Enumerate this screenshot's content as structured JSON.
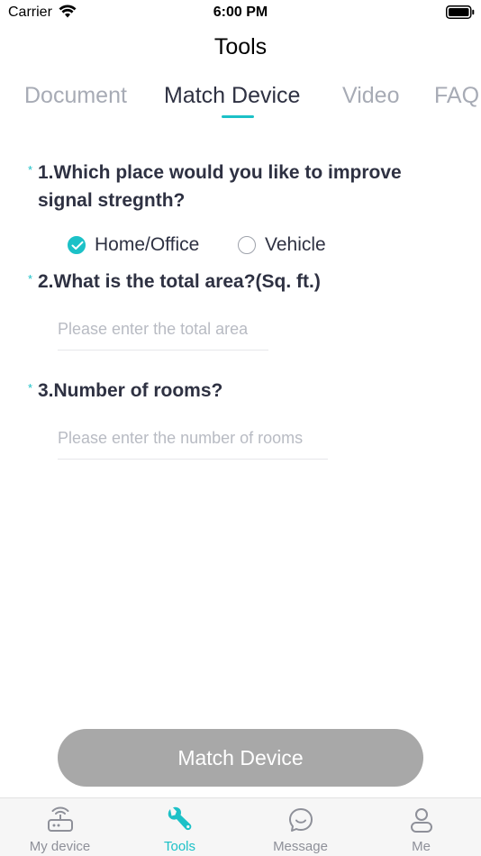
{
  "status_bar": {
    "carrier": "Carrier",
    "time": "6:00 PM"
  },
  "nav": {
    "title": "Tools"
  },
  "tabs": [
    {
      "label": "Document",
      "active": false
    },
    {
      "label": "Match Device",
      "active": true
    },
    {
      "label": "Video",
      "active": false
    },
    {
      "label": "FAQ",
      "active": false
    }
  ],
  "form": {
    "required_mark": "*",
    "q1": {
      "text": "1.Which place would you like to improve signal stregnth?",
      "options": [
        {
          "label": "Home/Office",
          "selected": true
        },
        {
          "label": "Vehicle",
          "selected": false
        }
      ]
    },
    "q2": {
      "text": "2.What is the total area?(Sq. ft.)",
      "placeholder": "Please enter the total area",
      "value": ""
    },
    "q3": {
      "text": "3.Number of rooms?",
      "placeholder": "Please enter the number of rooms",
      "value": ""
    }
  },
  "submit_button": {
    "label": "Match Device"
  },
  "tab_bar": [
    {
      "label": "My device",
      "icon": "router-icon",
      "active": false
    },
    {
      "label": "Tools",
      "icon": "wrench-icon",
      "active": true
    },
    {
      "label": "Message",
      "icon": "chat-bubble-icon",
      "active": false
    },
    {
      "label": "Me",
      "icon": "person-icon",
      "active": false
    }
  ],
  "colors": {
    "accent": "#1cc1c7",
    "text": "#2e3142",
    "inactive_tab": "#a7abb5",
    "button_disabled": "#a8a8a8"
  }
}
